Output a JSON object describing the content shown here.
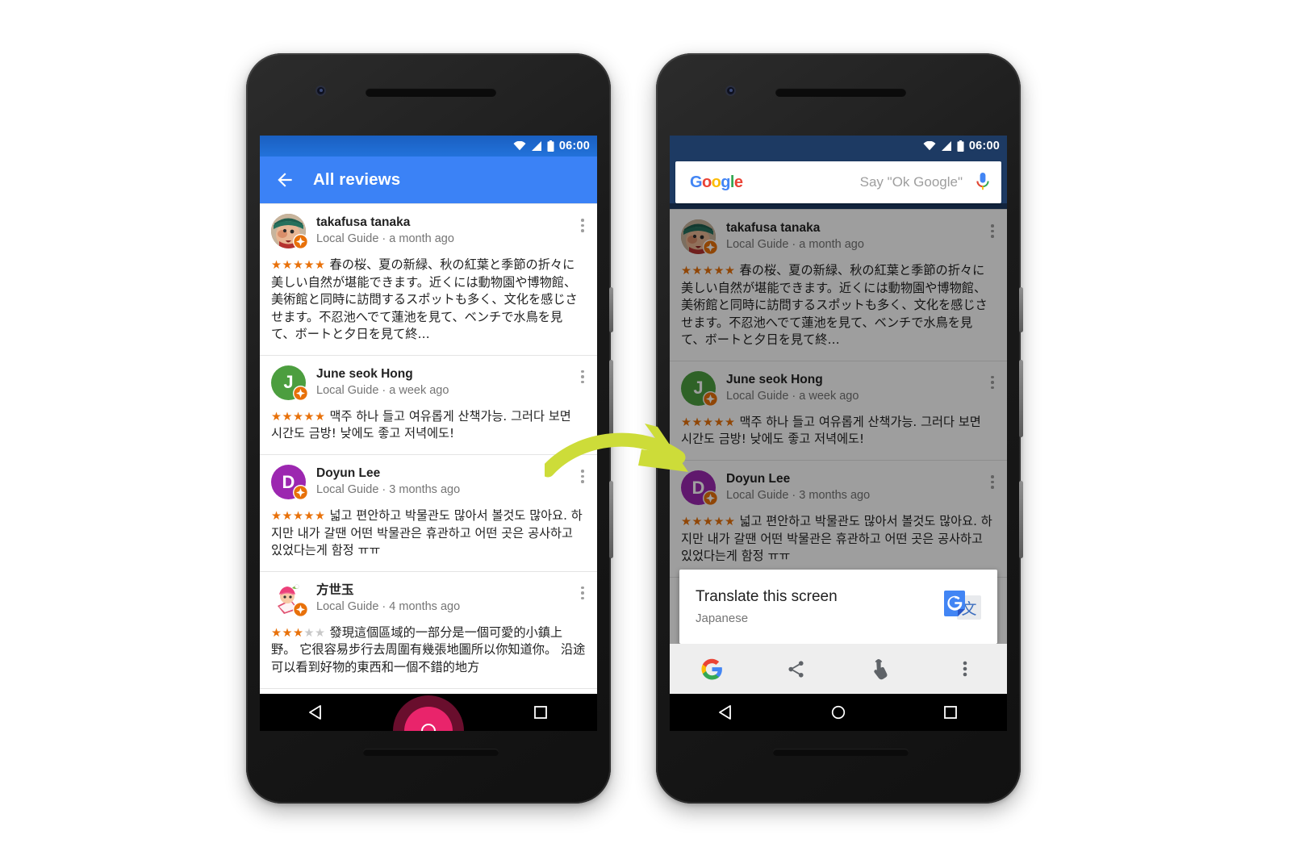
{
  "scene": {
    "background": "#ffffff",
    "arrow_color": "#cddc39",
    "description": "Two Android phones side by side showing Google Maps reviews and Now on Tap translate suggestion"
  },
  "status_bar": {
    "time": "06:00",
    "icons": [
      "wifi-icon",
      "signal-icon",
      "battery-icon"
    ]
  },
  "phone_left": {
    "app_bar": {
      "back_label": "back-arrow",
      "title": "All reviews",
      "background": "#3b82f6"
    },
    "nav": {
      "back": "back-triangle-icon",
      "home": "home-circle-icon",
      "recents": "recents-square-icon"
    },
    "tap_indicator": {
      "color": "#e9246b",
      "target": "home-button"
    }
  },
  "phone_right": {
    "search_bar": {
      "logo_letters": [
        "G",
        "o",
        "o",
        "g",
        "l",
        "e"
      ],
      "placeholder": "Say \"Ok Google\"",
      "mic_icon": "microphone-icon"
    },
    "translate_card": {
      "title": "Translate this screen",
      "subtitle": "Japanese",
      "icon": "google-translate-icon"
    },
    "action_bar": {
      "items": [
        {
          "name": "google-button",
          "icon": "google-g-icon"
        },
        {
          "name": "share-button",
          "icon": "share-icon"
        },
        {
          "name": "tap-button",
          "icon": "hand-tap-icon"
        },
        {
          "name": "overflow-button",
          "icon": "more-vert-icon"
        }
      ]
    },
    "scrim_opacity": 0.38
  },
  "reviews": [
    {
      "name": "takafusa tanaka",
      "meta": "Local Guide · a month ago",
      "rating": 5,
      "avatar_type": "photo-character",
      "avatar_color": "#c98a6a",
      "avatar_initial": "",
      "text": "春の桜、夏の新緑、秋の紅葉と季節の折々に美しい自然が堪能できます。近くには動物園や博物館、美術館と同時に訪問するスポットも多く、文化を感じさせます。不忍池へでて蓮池を見て、ベンチで水鳥を見て、ボートと夕日を見て終…"
    },
    {
      "name": "June seok Hong",
      "meta": "Local Guide · a week ago",
      "rating": 5,
      "avatar_type": "initial",
      "avatar_color": "#4c9e3f",
      "avatar_initial": "J",
      "text": "맥주 하나 들고 여유롭게 산책가능. 그러다 보면 시간도 금방! 낮에도 좋고 저녁에도!"
    },
    {
      "name": "Doyun Lee",
      "meta": "Local Guide · 3 months ago",
      "rating": 5,
      "avatar_type": "initial",
      "avatar_color": "#9c27b0",
      "avatar_initial": "D",
      "text": "넓고 편안하고 박물관도 많아서 볼것도 많아요. 하지만 내가 갈땐 어떤 박물관은 휴관하고 어떤 곳은 공사하고 있었다는게 함정 ㅠㅠ"
    },
    {
      "name": "方世玉",
      "meta": "Local Guide · 4 months ago",
      "rating": 3,
      "avatar_type": "photo-character",
      "avatar_color": "#f48fb1",
      "avatar_initial": "",
      "text": "發現這個區域的一部分是一個可愛的小鎮上野。 它很容易步行去周圍有幾張地圖所以你知道你。 沿途可以看到好物的東西和一個不錯的地方"
    }
  ],
  "colors": {
    "app_bar_blue": "#3b82f6",
    "status_blue": "#1b64c8",
    "status_dark_blue": "#1d3a63",
    "star_orange": "#e8710a",
    "star_grey": "#c8c8c8",
    "local_guide_badge": "#e8710a",
    "arrow_green": "#cddc39",
    "ripple_pink": "#e9246b"
  }
}
